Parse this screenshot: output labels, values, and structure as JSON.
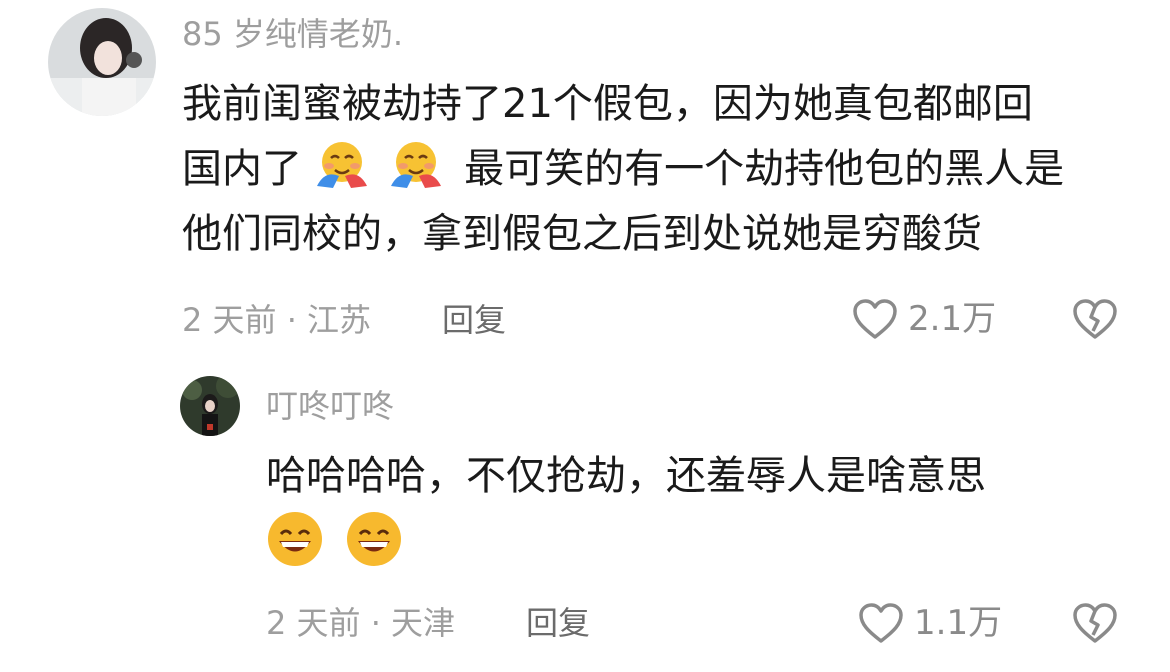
{
  "comments": [
    {
      "username": "85 岁纯情老奶.",
      "lines": [
        "我前闺蜜被劫持了21个假包，因为她真包都邮回",
        "国内了",
        "最可笑的有一个劫持他包的黑人是",
        "他们同校的，拿到假包之后到处说她是穷酸货"
      ],
      "inline_emojis": [
        "hugging-face-emoji",
        "hugging-face-emoji"
      ],
      "time_location": "2 天前 · 江苏",
      "reply_label": "回复",
      "likes": "2.1万"
    },
    {
      "username": "叮咚叮咚",
      "lines": [
        "哈哈哈哈，不仅抢劫，还羞辱人是啥意思"
      ],
      "inline_emojis": [
        "grinning-face-emoji",
        "grinning-face-emoji"
      ],
      "time_location": "2 天前 · 天津",
      "reply_label": "回复",
      "likes": "1.1万"
    }
  ],
  "colors": {
    "meta_gray": "#9e9e9e",
    "text": "#1a1a1a",
    "icon_gray": "#8a8a8a"
  }
}
